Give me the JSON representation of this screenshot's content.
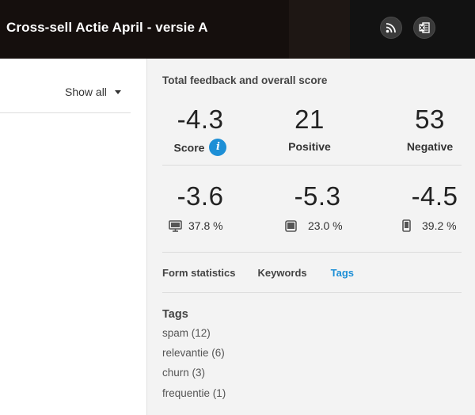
{
  "header": {
    "title": "Cross-sell Actie April - versie A",
    "rss_button": "rss-icon",
    "excel_button": "excel-icon"
  },
  "filter": {
    "show_all_label": "Show all"
  },
  "summary": {
    "title": "Total feedback and overall score",
    "score": {
      "value": "-4.3",
      "label": "Score"
    },
    "positive": {
      "value": "21",
      "label": "Positive"
    },
    "negative": {
      "value": "53",
      "label": "Negative"
    }
  },
  "devices": [
    {
      "icon": "desktop-icon",
      "score": "-3.6",
      "percent": "37.8 %"
    },
    {
      "icon": "tablet-icon",
      "score": "-5.3",
      "percent": "23.0 %"
    },
    {
      "icon": "mobile-icon",
      "score": "-4.5",
      "percent": "39.2 %"
    }
  ],
  "tabs": [
    {
      "label": "Form statistics",
      "active": false
    },
    {
      "label": "Keywords",
      "active": false
    },
    {
      "label": "Tags",
      "active": true
    }
  ],
  "tags": {
    "heading": "Tags",
    "items": [
      "spam (12)",
      "relevantie (6)",
      "churn (3)",
      "frequentie (1)"
    ]
  },
  "colors": {
    "accent": "#1d8fd6",
    "header_bg": "#1b1513",
    "panel_bg": "#f3f3f3"
  }
}
